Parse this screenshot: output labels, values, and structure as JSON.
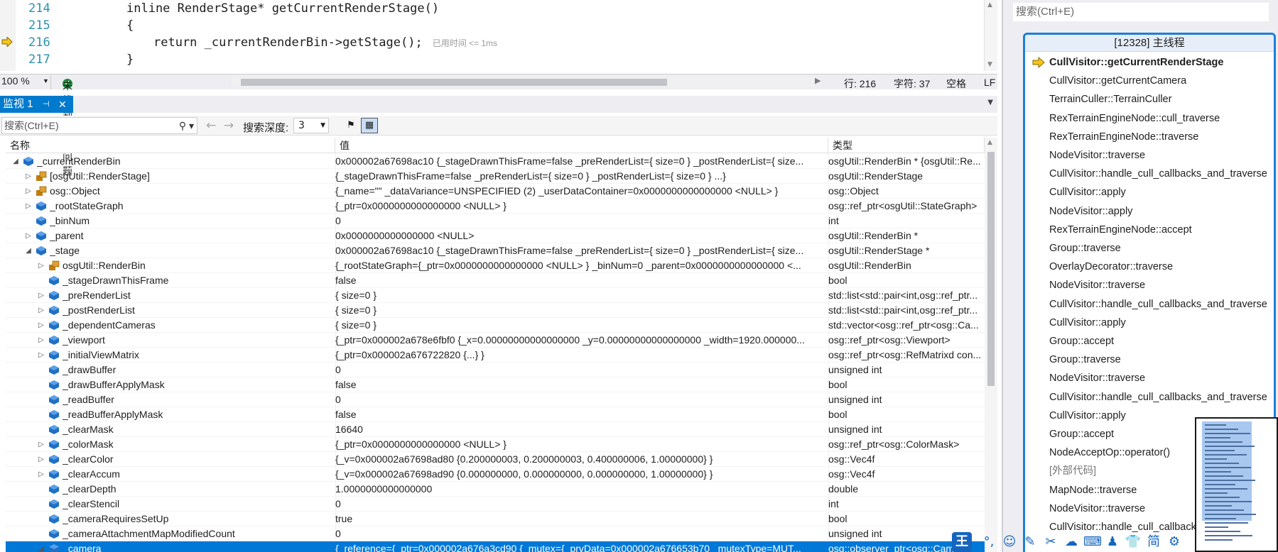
{
  "editor": {
    "lines": [
      {
        "num": "214",
        "code": "inline RenderStage* getCurrentRenderStage()",
        "indent": 0
      },
      {
        "num": "215",
        "code": "{",
        "indent": 0
      },
      {
        "num": "216",
        "code": "return _currentRenderBin->getStage();",
        "indent": 1,
        "elapsed": "已用时间 <= 1ms"
      },
      {
        "num": "217",
        "code": "}",
        "indent": 0
      }
    ]
  },
  "status": {
    "zoom": "100 %",
    "issues": "未找到相关问题",
    "line": "行: 216",
    "char": "字符: 37",
    "space": "空格",
    "eol": "LF"
  },
  "watch": {
    "tab_label": "监视 1",
    "search_placeholder": "搜索(Ctrl+E)",
    "depth_label": "搜索深度:",
    "depth_value": "3",
    "columns": {
      "name": "名称",
      "value": "值",
      "type": "类型"
    },
    "rows": [
      {
        "indent": 0,
        "exp": "▲",
        "icon": "object",
        "name": "_currentRenderBin",
        "value": "0x000002a67698ac10 {_stageDrawnThisFrame=false _preRenderList={ size=0 } _postRenderList={ size...",
        "type": "osgUtil::RenderBin * {osgUtil::Re..."
      },
      {
        "indent": 1,
        "exp": "▷",
        "icon": "base",
        "name": "[osgUtil::RenderStage]",
        "value": "{_stageDrawnThisFrame=false _preRenderList={ size=0 } _postRenderList={ size=0 } ...}",
        "type": "osgUtil::RenderStage"
      },
      {
        "indent": 1,
        "exp": "▷",
        "icon": "base",
        "name": "osg::Object",
        "value": "{_name=\"\" _dataVariance=UNSPECIFIED (2) _userDataContainer=0x0000000000000000 <NULL> }",
        "type": "osg::Object"
      },
      {
        "indent": 1,
        "exp": "▷",
        "icon": "object",
        "name": "_rootStateGraph",
        "value": "{_ptr=0x0000000000000000 <NULL> }",
        "type": "osg::ref_ptr<osgUtil::StateGraph>"
      },
      {
        "indent": 1,
        "exp": "",
        "icon": "object",
        "name": "_binNum",
        "value": "0",
        "type": "int"
      },
      {
        "indent": 1,
        "exp": "▷",
        "icon": "object",
        "name": "_parent",
        "value": "0x0000000000000000 <NULL>",
        "type": "osgUtil::RenderBin *"
      },
      {
        "indent": 1,
        "exp": "▲",
        "icon": "object",
        "name": "_stage",
        "value": "0x000002a67698ac10 {_stageDrawnThisFrame=false _preRenderList={ size=0 } _postRenderList={ size...",
        "type": "osgUtil::RenderStage *"
      },
      {
        "indent": 2,
        "exp": "▷",
        "icon": "base",
        "name": "osgUtil::RenderBin",
        "value": "{_rootStateGraph={_ptr=0x0000000000000000 <NULL> } _binNum=0 _parent=0x0000000000000000 <...",
        "type": "osgUtil::RenderBin"
      },
      {
        "indent": 2,
        "exp": "",
        "icon": "object",
        "name": "_stageDrawnThisFrame",
        "value": "false",
        "type": "bool"
      },
      {
        "indent": 2,
        "exp": "▷",
        "icon": "object",
        "name": "_preRenderList",
        "value": "{ size=0 }",
        "type": "std::list<std::pair<int,osg::ref_ptr..."
      },
      {
        "indent": 2,
        "exp": "▷",
        "icon": "object",
        "name": "_postRenderList",
        "value": "{ size=0 }",
        "type": "std::list<std::pair<int,osg::ref_ptr..."
      },
      {
        "indent": 2,
        "exp": "▷",
        "icon": "object",
        "name": "_dependentCameras",
        "value": "{ size=0 }",
        "type": "std::vector<osg::ref_ptr<osg::Ca..."
      },
      {
        "indent": 2,
        "exp": "▷",
        "icon": "object",
        "name": "_viewport",
        "value": "{_ptr=0x000002a678e6fbf0 {_x=0.00000000000000000 _y=0.00000000000000000 _width=1920.000000...",
        "type": "osg::ref_ptr<osg::Viewport>"
      },
      {
        "indent": 2,
        "exp": "▷",
        "icon": "object",
        "name": "_initialViewMatrix",
        "value": "{_ptr=0x000002a676722820 {...} }",
        "type": "osg::ref_ptr<osg::RefMatrixd con..."
      },
      {
        "indent": 2,
        "exp": "",
        "icon": "object",
        "name": "_drawBuffer",
        "value": "0",
        "type": "unsigned int"
      },
      {
        "indent": 2,
        "exp": "",
        "icon": "object",
        "name": "_drawBufferApplyMask",
        "value": "false",
        "type": "bool"
      },
      {
        "indent": 2,
        "exp": "",
        "icon": "object",
        "name": "_readBuffer",
        "value": "0",
        "type": "unsigned int"
      },
      {
        "indent": 2,
        "exp": "",
        "icon": "object",
        "name": "_readBufferApplyMask",
        "value": "false",
        "type": "bool"
      },
      {
        "indent": 2,
        "exp": "",
        "icon": "object",
        "name": "_clearMask",
        "value": "16640",
        "type": "unsigned int"
      },
      {
        "indent": 2,
        "exp": "▷",
        "icon": "object",
        "name": "_colorMask",
        "value": "{_ptr=0x0000000000000000 <NULL> }",
        "type": "osg::ref_ptr<osg::ColorMask>"
      },
      {
        "indent": 2,
        "exp": "▷",
        "icon": "object",
        "name": "_clearColor",
        "value": "{_v=0x000002a67698ad80 {0.200000003, 0.200000003, 0.400000006, 1.00000000} }",
        "type": "osg::Vec4f"
      },
      {
        "indent": 2,
        "exp": "▷",
        "icon": "object",
        "name": "_clearAccum",
        "value": "{_v=0x000002a67698ad90 {0.000000000, 0.000000000, 0.000000000, 1.00000000} }",
        "type": "osg::Vec4f"
      },
      {
        "indent": 2,
        "exp": "",
        "icon": "object",
        "name": "_clearDepth",
        "value": "1.0000000000000000",
        "type": "double"
      },
      {
        "indent": 2,
        "exp": "",
        "icon": "object",
        "name": "_clearStencil",
        "value": "0",
        "type": "int"
      },
      {
        "indent": 2,
        "exp": "",
        "icon": "object",
        "name": "_cameraRequiresSetUp",
        "value": "true",
        "type": "bool"
      },
      {
        "indent": 2,
        "exp": "",
        "icon": "object",
        "name": "_cameraAttachmentMapModifiedCount",
        "value": "0",
        "type": "unsigned int"
      },
      {
        "indent": 2,
        "exp": "▲",
        "icon": "object",
        "name": "_camera",
        "value": "{_reference={_ptr=0x000002a676a3cd90 {_mutex={_prvData=0x000002a676653b70 _mutexType=MUT...",
        "type": "osg::observer_ptr<osg::Cam...",
        "selected": true
      }
    ]
  },
  "callstack": {
    "search_placeholder": "搜索(Ctrl+E)",
    "title": "[12328] 主线程",
    "frames": [
      {
        "label": "CullVisitor::getCurrentRenderStage",
        "current": true
      },
      {
        "label": "CullVisitor::getCurrentCamera"
      },
      {
        "label": "TerrainCuller::TerrainCuller"
      },
      {
        "label": "RexTerrainEngineNode::cull_traverse"
      },
      {
        "label": "RexTerrainEngineNode::traverse"
      },
      {
        "label": "NodeVisitor::traverse"
      },
      {
        "label": "CullVisitor::handle_cull_callbacks_and_traverse"
      },
      {
        "label": "CullVisitor::apply"
      },
      {
        "label": "NodeVisitor::apply"
      },
      {
        "label": "RexTerrainEngineNode::accept"
      },
      {
        "label": "Group::traverse"
      },
      {
        "label": "OverlayDecorator::traverse"
      },
      {
        "label": "NodeVisitor::traverse"
      },
      {
        "label": "CullVisitor::handle_cull_callbacks_and_traverse"
      },
      {
        "label": "CullVisitor::apply"
      },
      {
        "label": "Group::accept"
      },
      {
        "label": "Group::traverse"
      },
      {
        "label": "NodeVisitor::traverse"
      },
      {
        "label": "CullVisitor::handle_cull_callbacks_and_traverse"
      },
      {
        "label": "CullVisitor::apply"
      },
      {
        "label": "Group::accept"
      },
      {
        "label": "NodeAcceptOp::operator()"
      },
      {
        "label": "[外部代码]",
        "external": true
      },
      {
        "label": "MapNode::traverse"
      },
      {
        "label": "NodeVisitor::traverse"
      },
      {
        "label": "CullVisitor::handle_cull_callback"
      }
    ]
  },
  "ime": {
    "logo": "王",
    "simplified": "简",
    "icons": [
      "punctuation-icon",
      "emoji-icon",
      "pen-icon",
      "scissors-icon",
      "cloud-icon",
      "keyboard-icon",
      "user-icon",
      "shirt-icon",
      "simplified-icon",
      "settings-icon"
    ]
  },
  "colors": {
    "accent": "#007acc",
    "selected_row": "#0078d7",
    "exec_arrow": "#f5c518",
    "callstack_border": "#1e7fd8"
  }
}
